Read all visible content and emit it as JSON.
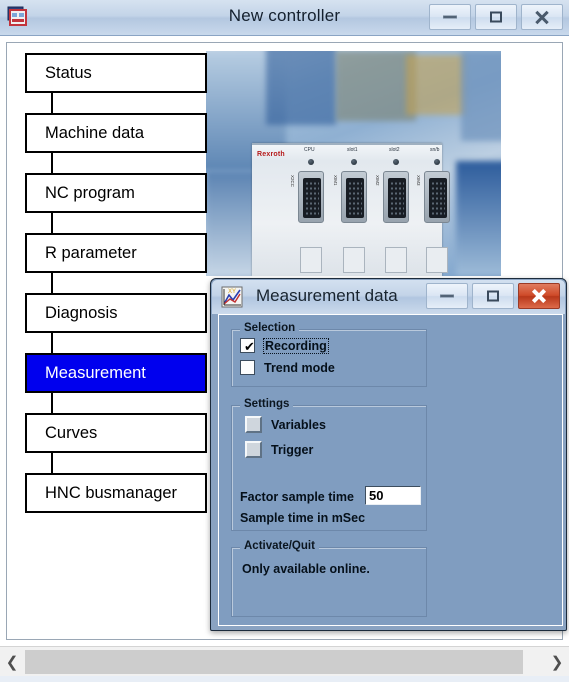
{
  "main_window": {
    "title": "New controller",
    "icon": "application-window-icon",
    "controls": {
      "minimize": "minimize-icon",
      "maximize": "maximize-icon",
      "close": "close-icon"
    }
  },
  "navigation": {
    "items": [
      {
        "label": "Status",
        "selected": false
      },
      {
        "label": "Machine data",
        "selected": false
      },
      {
        "label": "NC program",
        "selected": false
      },
      {
        "label": "R parameter",
        "selected": false
      },
      {
        "label": "Diagnosis",
        "selected": false
      },
      {
        "label": "Measurement",
        "selected": true
      },
      {
        "label": "Curves",
        "selected": false
      },
      {
        "label": "HNC busmanager",
        "selected": false
      }
    ],
    "selected_color": "#0000ee",
    "selected_text_color": "#ffffff"
  },
  "photo": {
    "alt": "rexroth-controller-photo",
    "brand": "Rexroth",
    "port_labels": [
      "CPU",
      "slot1",
      "slot2",
      "sn/b"
    ],
    "connector_labels": [
      "X2CC",
      "XIM1",
      "XIM2",
      "XIM3"
    ]
  },
  "dialog": {
    "title": "Measurement data",
    "icon": "xy-chart-icon",
    "controls": {
      "minimize": "minimize-icon",
      "maximize": "maximize-icon",
      "close": "close-icon"
    },
    "groups": {
      "selection": {
        "label": "Selection",
        "options": [
          {
            "label": "Recording",
            "checked": true,
            "focused": true
          },
          {
            "label": "Trend mode",
            "checked": false,
            "focused": false
          }
        ]
      },
      "settings": {
        "label": "Settings",
        "buttons": [
          {
            "label": "Variables"
          },
          {
            "label": "Trigger"
          }
        ],
        "factor_label": "Factor sample time",
        "factor_value": "50",
        "unit_label": "Sample time in mSec"
      },
      "activate_quit": {
        "label": "Activate/Quit",
        "message": "Only available online."
      }
    },
    "background_color": "#809dc0"
  },
  "scrollbar": {
    "left_arrow": "chevron-left-icon",
    "right_arrow": "chevron-right-icon"
  }
}
